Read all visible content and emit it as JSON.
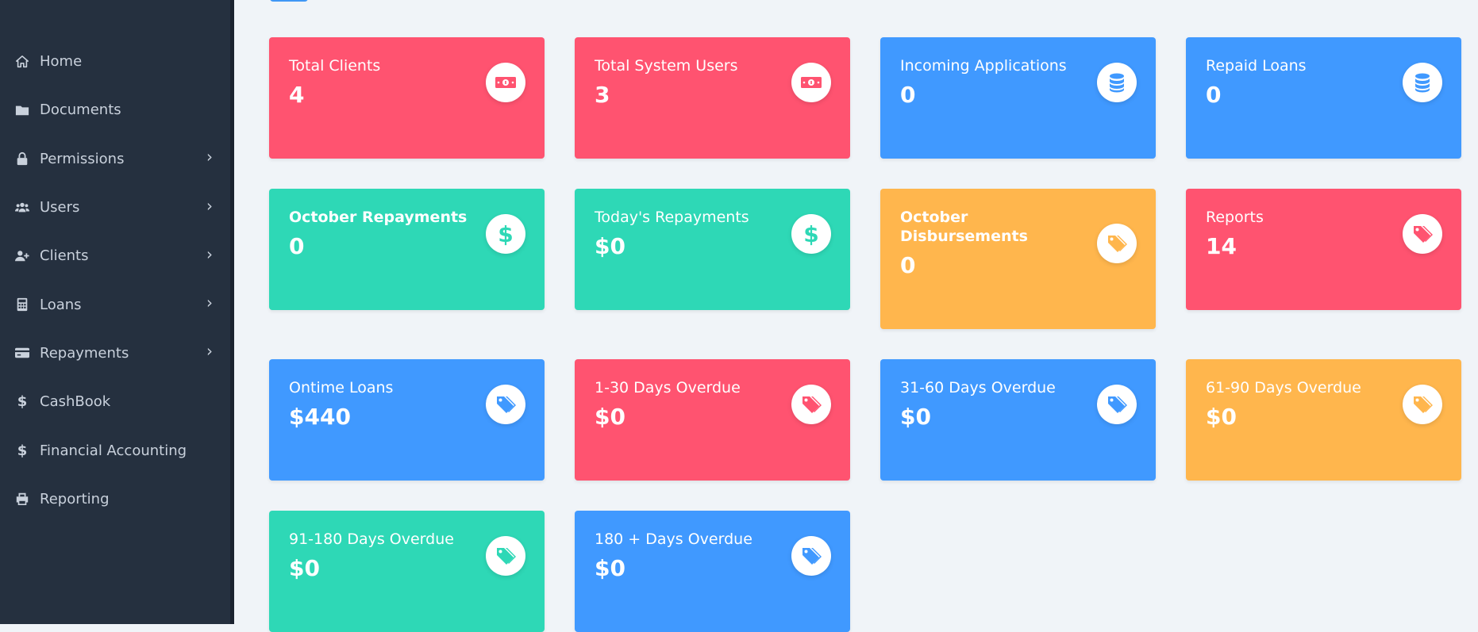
{
  "sidebar": {
    "items": [
      {
        "label": "Home",
        "icon": "home-icon",
        "has_submenu": false
      },
      {
        "label": "Documents",
        "icon": "folder-icon",
        "has_submenu": false
      },
      {
        "label": "Permissions",
        "icon": "lock-icon",
        "has_submenu": true
      },
      {
        "label": "Users",
        "icon": "users-icon",
        "has_submenu": true
      },
      {
        "label": "Clients",
        "icon": "user-plus-icon",
        "has_submenu": true
      },
      {
        "label": "Loans",
        "icon": "calculator-icon",
        "has_submenu": true
      },
      {
        "label": "Repayments",
        "icon": "credit-card-icon",
        "has_submenu": true
      },
      {
        "label": "CashBook",
        "icon": "dollar-icon",
        "has_submenu": false
      },
      {
        "label": "Financial Accounting",
        "icon": "dollar-icon",
        "has_submenu": false
      },
      {
        "label": "Reporting",
        "icon": "printer-icon",
        "has_submenu": false
      }
    ],
    "chevron": "›"
  },
  "colors": {
    "red": "#ff5370",
    "blue": "#4099ff",
    "green": "#2ed8b6",
    "orange": "#ffb64d",
    "sidebar_bg": "#25303f",
    "page_bg": "#f0f4f8"
  },
  "cards": [
    {
      "title": "Total Clients",
      "value": "4",
      "color": "red",
      "icon": "money-bill-icon"
    },
    {
      "title": "Total System Users",
      "value": "3",
      "color": "red",
      "icon": "money-bill-icon"
    },
    {
      "title": "Incoming Applications",
      "value": "0",
      "color": "blue",
      "icon": "database-icon"
    },
    {
      "title": "Repaid Loans",
      "value": "0",
      "color": "blue",
      "icon": "database-icon"
    },
    {
      "title": "October Repayments",
      "value": "0",
      "color": "green",
      "icon": "dollar-icon"
    },
    {
      "title": "Today's Repayments",
      "value": "$0",
      "color": "green",
      "icon": "dollar-icon"
    },
    {
      "title": "October Disbursements",
      "value": "0",
      "color": "orange",
      "icon": "tags-icon"
    },
    {
      "title": "Reports",
      "value": "14",
      "color": "red",
      "icon": "tags-icon"
    },
    {
      "title": "Ontime Loans",
      "value": "$440",
      "color": "blue",
      "icon": "tags-icon"
    },
    {
      "title": "1-30 Days Overdue",
      "value": "$0",
      "color": "red",
      "icon": "tags-icon"
    },
    {
      "title": "31-60 Days Overdue",
      "value": "$0",
      "color": "blue",
      "icon": "tags-icon"
    },
    {
      "title": "61-90 Days Overdue",
      "value": "$0",
      "color": "orange",
      "icon": "tags-icon"
    },
    {
      "title": "91-180 Days Overdue",
      "value": "$0",
      "color": "green",
      "icon": "tags-icon"
    },
    {
      "title": "180 + Days Overdue",
      "value": "$0",
      "color": "blue",
      "icon": "tags-icon"
    }
  ]
}
